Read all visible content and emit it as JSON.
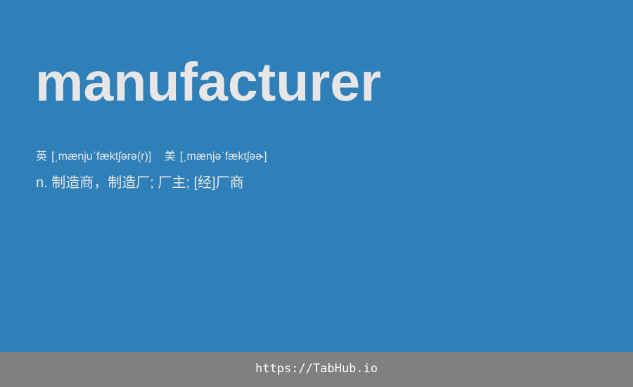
{
  "entry": {
    "word": "manufacturer",
    "phonetics": {
      "uk": {
        "label": "英",
        "ipa": "[ˌmænjuˈfæktʃərə(r)]"
      },
      "us": {
        "label": "美",
        "ipa": "[ˌmænjəˈfæktʃəɚ]"
      }
    },
    "definition": "n. 制造商，制造厂; 厂主; [经]厂商"
  },
  "footer": {
    "link_text": "https://TabHub.io"
  },
  "colors": {
    "background": "#2f80b9",
    "text": "#e6e6e6",
    "footer_background": "#808080",
    "footer_text": "#ffffff"
  }
}
